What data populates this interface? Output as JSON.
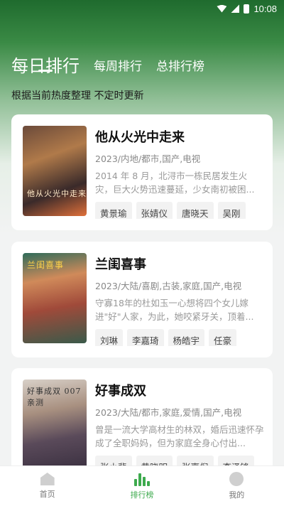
{
  "status": {
    "time": "10:08"
  },
  "tabs": {
    "daily": "每日排行",
    "weekly": "每周排行",
    "overall": "总排行榜"
  },
  "subtitle": "根据当前热度整理 不定时更新",
  "items": [
    {
      "title": "他从火光中走来",
      "meta": "2023/内地/都市,国产,电视",
      "desc": "2014 年 8 月，北浔市一栋民居发生火灾，巨大火势迅速蔓延，少女南初被困...",
      "poster_text": "他从火光中走来",
      "actors": [
        "黄景瑜",
        "张婧仪",
        "唐晓天",
        "吴刚"
      ]
    },
    {
      "title": "兰闺喜事",
      "meta": "2023/大陆/喜剧,古装,家庭,国产,电视",
      "desc": "守寡18年的杜如玉一心想将四个女儿嫁进\"好\"人家，为此，她咬紧牙关，顶着...",
      "poster_text": "兰闺喜事",
      "actors": [
        "刘琳",
        "李嘉琦",
        "杨皓宇",
        "任豪"
      ]
    },
    {
      "title": "好事成双",
      "meta": "2023/大陆/都市,家庭,爱情,国产,电视",
      "desc": "曾是一流大学高材生的林双，婚后迅速怀孕成了全职妈妈，但为家庭全身心付出...",
      "poster_text": "好事成双 007亲测",
      "actors": [
        "张小斐",
        "黄晓明",
        "张嘉倪",
        "李泽锋"
      ]
    }
  ],
  "nav": {
    "home": "首页",
    "rank": "排行榜",
    "me": "我的"
  },
  "colors": {
    "accent": "#3daa4d",
    "header": "#2f7d3a"
  }
}
